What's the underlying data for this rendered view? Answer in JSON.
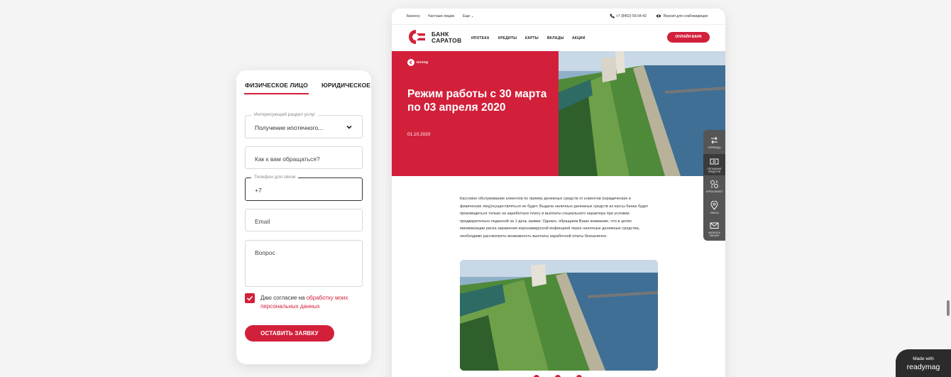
{
  "form": {
    "tabs": [
      "ФИЗИЧЕСКОЕ ЛИЦО",
      "ЮРИДИЧЕСКОЕ"
    ],
    "service_label": "Интересующий раздел услуг",
    "service_value": "Получение ипотечного...",
    "name_placeholder": "Как к вам обращаться?",
    "phone_label": "Телефон для связи",
    "phone_value": "+7",
    "email_placeholder": "Email",
    "question_placeholder": "Вопрос",
    "consent_prefix": "Даю согласие на ",
    "consent_link": "обработку моих персональных данных",
    "consent_checked": true,
    "submit_label": "ОСТАВИТЬ ЗАЯВКУ"
  },
  "site": {
    "topbar": {
      "links": [
        "Бизнесу",
        "Частным лицам",
        "Еще"
      ],
      "phone": "+7 (8452) 56-04-42",
      "accessibility": "Версия для слабовидящих"
    },
    "logo": {
      "line1": "БАНК",
      "line2": "САРАТОВ"
    },
    "nav": [
      "ИПОТЕКА",
      "КРЕДИТЫ",
      "КАРТЫ",
      "ВКЛАДЫ",
      "АКЦИИ"
    ],
    "online_bank": "ОНЛАЙН-БАНК",
    "hero": {
      "back": "НАЗАД",
      "title": "Режим работы с 30 марта по 03 апреля 2020",
      "date": "01.10.2020"
    },
    "article": "Кассовое обслуживание клиентов по приему денежных средств от клиентов (юридических и физических лиц)осуществляться не будет. Выдача наличных денежных средств из кассы банка будет производиться только на заработную плату и выплаты социального характера при условии предварительно поданной за 1 день заявки. Однако, обращаем Ваше внимание, что в целях минимизации риска заражения коронавирусной инфекцией через наличные денежные средства, необходимо рассмотреть возможность выплаты заработной платы безналично.",
    "side_widget": [
      "ПЕРЕВОДЫ",
      "ПОГАШЕНИЕ КРЕДИТОВ",
      "КУРСЫ ВАЛЮТ",
      "ОФИСЫ",
      "НАПИСАТЬ ПИСЬМО"
    ]
  },
  "badge": {
    "line1": "Made with",
    "line2": "readymag"
  },
  "colors": {
    "brand_red": "#d2203b",
    "widget_gray": "#555555"
  }
}
